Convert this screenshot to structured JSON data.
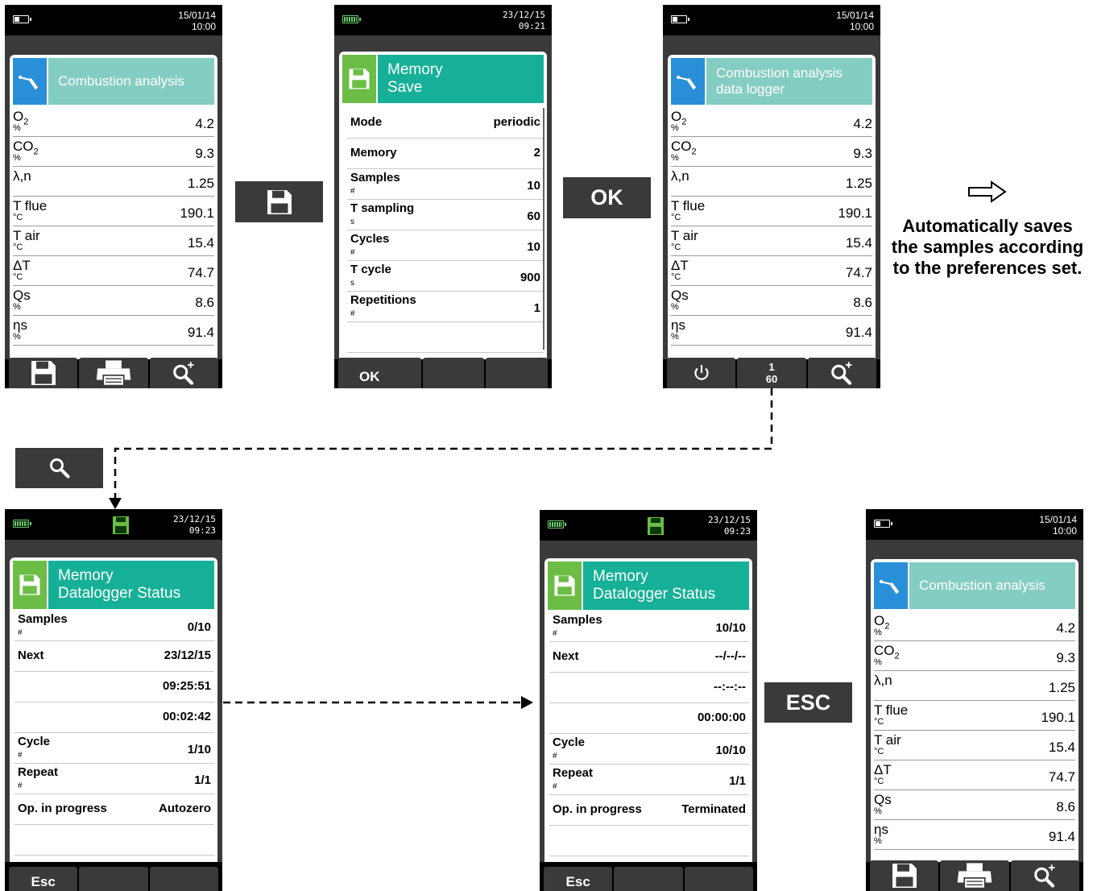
{
  "screen_a": {
    "date": "15/01/14",
    "time": "10:00",
    "title": "Combustion analysis",
    "rows": [
      {
        "label": "O",
        "sub": "2",
        "unit": "%",
        "value": "4.2"
      },
      {
        "label": "CO",
        "sub": "2",
        "unit": "%",
        "value": "9.3"
      },
      {
        "label": "λ,n",
        "sub": "",
        "unit": "",
        "value": "1.25"
      },
      {
        "label": "T flue",
        "sub": "",
        "unit": "°C",
        "value": "190.1"
      },
      {
        "label": "T air",
        "sub": "",
        "unit": "°C",
        "value": "15.4"
      },
      {
        "label": "ΔT",
        "sub": "",
        "unit": "°C",
        "value": "74.7"
      },
      {
        "label": "Qs",
        "sub": "",
        "unit": "%",
        "value": "8.6"
      },
      {
        "label": "ηs",
        "sub": "",
        "unit": "%",
        "value": "91.4"
      }
    ],
    "buttons": [
      "save-icon",
      "printer-icon",
      "zoom-icon"
    ]
  },
  "key_save": {
    "icon": "save-icon"
  },
  "screen_b": {
    "date": "23/12/15",
    "time": "09:21",
    "title_line1": "Memory",
    "title_line2": "Save",
    "rows": [
      {
        "label": "Mode",
        "unit": "",
        "value": "periodic"
      },
      {
        "label": "Memory",
        "unit": "",
        "value": "2"
      },
      {
        "label": "Samples",
        "unit": "#",
        "value": "10"
      },
      {
        "label": "T sampling",
        "unit": "s",
        "value": "60"
      },
      {
        "label": "Cycles",
        "unit": "#",
        "value": "10"
      },
      {
        "label": "T cycle",
        "unit": "s",
        "value": "900"
      },
      {
        "label": "Repetitions",
        "unit": "#",
        "value": "1"
      }
    ],
    "buttons": [
      "OK",
      "",
      ""
    ]
  },
  "key_ok": {
    "label": "OK"
  },
  "screen_c": {
    "date": "15/01/14",
    "time": "10:00",
    "title_line1": "Combustion analysis",
    "title_line2": "data logger",
    "rows": [
      {
        "label": "O",
        "sub": "2",
        "unit": "%",
        "value": "4.2"
      },
      {
        "label": "CO",
        "sub": "2",
        "unit": "%",
        "value": "9.3"
      },
      {
        "label": "λ,n",
        "sub": "",
        "unit": "",
        "value": "1.25"
      },
      {
        "label": "T flue",
        "sub": "",
        "unit": "°C",
        "value": "190.1"
      },
      {
        "label": "T air",
        "sub": "",
        "unit": "°C",
        "value": "15.4"
      },
      {
        "label": "ΔT",
        "sub": "",
        "unit": "°C",
        "value": "74.7"
      },
      {
        "label": "Qs",
        "sub": "",
        "unit": "%",
        "value": "8.6"
      },
      {
        "label": "ηs",
        "sub": "",
        "unit": "%",
        "value": "91.4"
      }
    ],
    "button_mid_top": "1",
    "button_mid_bottom": "60",
    "buttons": [
      "power-icon",
      "counter",
      "zoom-icon"
    ]
  },
  "note": {
    "arrow_icon": "right-arrow-icon",
    "text": "Automatically saves the samples according to the preferences set."
  },
  "key_zoom": {
    "icon": "zoom-icon"
  },
  "screen_d": {
    "date": "23/12/15",
    "time": "09:23",
    "title_line1": "Memory",
    "title_line2": "Datalogger Status",
    "rows": [
      {
        "label": "Samples",
        "unit": "#",
        "value": "0/10"
      },
      {
        "label": "Next",
        "unit": "",
        "value": "23/12/15"
      },
      {
        "label": "",
        "unit": "",
        "value": "09:25:51"
      },
      {
        "label": "",
        "unit": "",
        "value": "00:02:42"
      },
      {
        "label": "Cycle",
        "unit": "#",
        "value": "1/10"
      },
      {
        "label": "Repeat",
        "unit": "#",
        "value": "1/1"
      },
      {
        "label": "Op. in progress",
        "unit": "",
        "value": "Autozero"
      }
    ],
    "buttons": [
      "Esc",
      "",
      ""
    ]
  },
  "screen_e": {
    "date": "23/12/15",
    "time": "09:23",
    "title_line1": "Memory",
    "title_line2": "Datalogger Status",
    "rows": [
      {
        "label": "Samples",
        "unit": "#",
        "value": "10/10"
      },
      {
        "label": "Next",
        "unit": "",
        "value": "--/--/--"
      },
      {
        "label": "",
        "unit": "",
        "value": "--:--:--"
      },
      {
        "label": "",
        "unit": "",
        "value": "00:00:00"
      },
      {
        "label": "Cycle",
        "unit": "#",
        "value": "10/10"
      },
      {
        "label": "Repeat",
        "unit": "#",
        "value": "1/1"
      },
      {
        "label": "Op. in progress",
        "unit": "",
        "value": "Terminated"
      }
    ],
    "buttons": [
      "Esc",
      "",
      ""
    ]
  },
  "key_esc": {
    "label": "ESC"
  },
  "screen_f": {
    "date": "15/01/14",
    "time": "10:00",
    "title": "Combustion analysis",
    "rows": [
      {
        "label": "O",
        "sub": "2",
        "unit": "%",
        "value": "4.2"
      },
      {
        "label": "CO",
        "sub": "2",
        "unit": "%",
        "value": "9.3"
      },
      {
        "label": "λ,n",
        "sub": "",
        "unit": "",
        "value": "1.25"
      },
      {
        "label": "T flue",
        "sub": "",
        "unit": "°C",
        "value": "190.1"
      },
      {
        "label": "T air",
        "sub": "",
        "unit": "°C",
        "value": "15.4"
      },
      {
        "label": "ΔT",
        "sub": "",
        "unit": "°C",
        "value": "74.7"
      },
      {
        "label": "Qs",
        "sub": "",
        "unit": "%",
        "value": "8.6"
      },
      {
        "label": "ηs",
        "sub": "",
        "unit": "%",
        "value": "91.4"
      }
    ],
    "buttons": [
      "save-icon",
      "printer-icon",
      "zoom-icon"
    ]
  }
}
